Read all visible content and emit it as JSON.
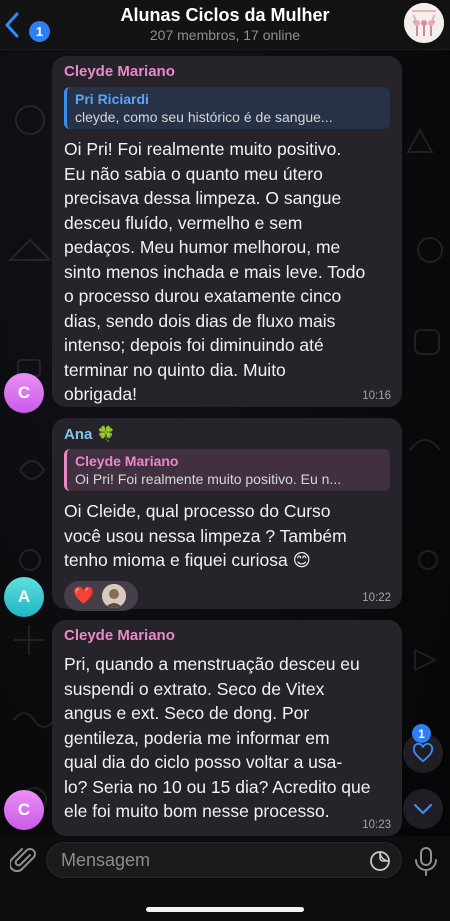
{
  "header": {
    "back_badge": "1",
    "title": "Alunas Ciclos da Mulher",
    "subtitle": "207 membros, 17 online"
  },
  "messages": [
    {
      "sender": "Cleyde Mariano",
      "reply_to": {
        "name": "Pri Riciardi",
        "text": "cleyde, como seu histórico é de sangue..."
      },
      "text": "Oi Pri! Foi realmente muito positivo.\nEu não sabia o quanto meu útero\nprecisava dessa limpeza. O sangue\ndesceu fluído, vermelho e sem\npedaços. Meu humor melhorou, me\nsinto menos inchada e mais leve. Todo\no processo durou exatamente cinco\ndias, sendo dois dias de fluxo mais\nintenso; depois foi diminuindo até\nterminar no quinto dia. Muito\nobrigada!",
      "time": "10:16",
      "avatar_letter": "C"
    },
    {
      "sender": "Ana 🍀",
      "reply_to": {
        "name": "Cleyde Mariano",
        "text": "Oi Pri! Foi realmente muito positivo. Eu n..."
      },
      "text": "Oi Cleide, qual processo do Curso\nvocê usou nessa limpeza ? Também\ntenho mioma e fiquei curiosa 😊",
      "reaction": "❤️",
      "time": "10:22",
      "avatar_letter": "A"
    },
    {
      "sender": "Cleyde Mariano",
      "text": "Pri, quando a menstruação desceu eu\nsuspendi o extrato. Seco de Vitex\nangus e ext. Seco de dong. Por\ngentileza, poderia me informar em\nqual dia do ciclo posso voltar a usa-\nlo? Seria no 10 ou 15 dia? Acredito que\nele foi muito bom nesse processo.",
      "time": "10:23",
      "avatar_letter": "C"
    }
  ],
  "floating": {
    "reactions_badge": "1"
  },
  "input": {
    "placeholder": "Mensagem"
  },
  "colors": {
    "accent_blue": "#2f7ef6",
    "sender_pink": "#e98ac7",
    "sender_cyan": "#7ec6ee",
    "bubble_bg": "#28242c"
  },
  "icons": [
    "chevron-left-icon",
    "paperclip-icon",
    "sticker-icon",
    "microphone-icon",
    "heart-icon",
    "chevron-down-icon"
  ]
}
